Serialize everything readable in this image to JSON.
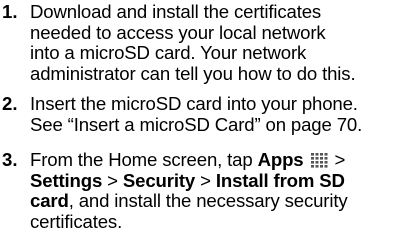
{
  "steps": [
    {
      "number": "1.",
      "lines": [
        "Download and install the certificates",
        "needed to access your local network",
        "into a microSD card. Your network",
        "administrator can tell you how to do this."
      ]
    },
    {
      "number": "2.",
      "lines": [
        "Insert the microSD card into your phone.",
        "See “Insert a microSD Card” on page 70."
      ]
    },
    {
      "number": "3.",
      "line1_prefix": "From the Home screen, tap ",
      "apps_label": "Apps",
      "apps_icon": "apps-grid-icon",
      "line1_suffix": " >",
      "settings_label": "Settings",
      "sep1": " > ",
      "security_label": "Security",
      "sep2": " > ",
      "install_label_a": "Install from SD",
      "install_label_b": "card",
      "line3_suffix": ", and install the necessary security",
      "line4": "certificates."
    }
  ]
}
